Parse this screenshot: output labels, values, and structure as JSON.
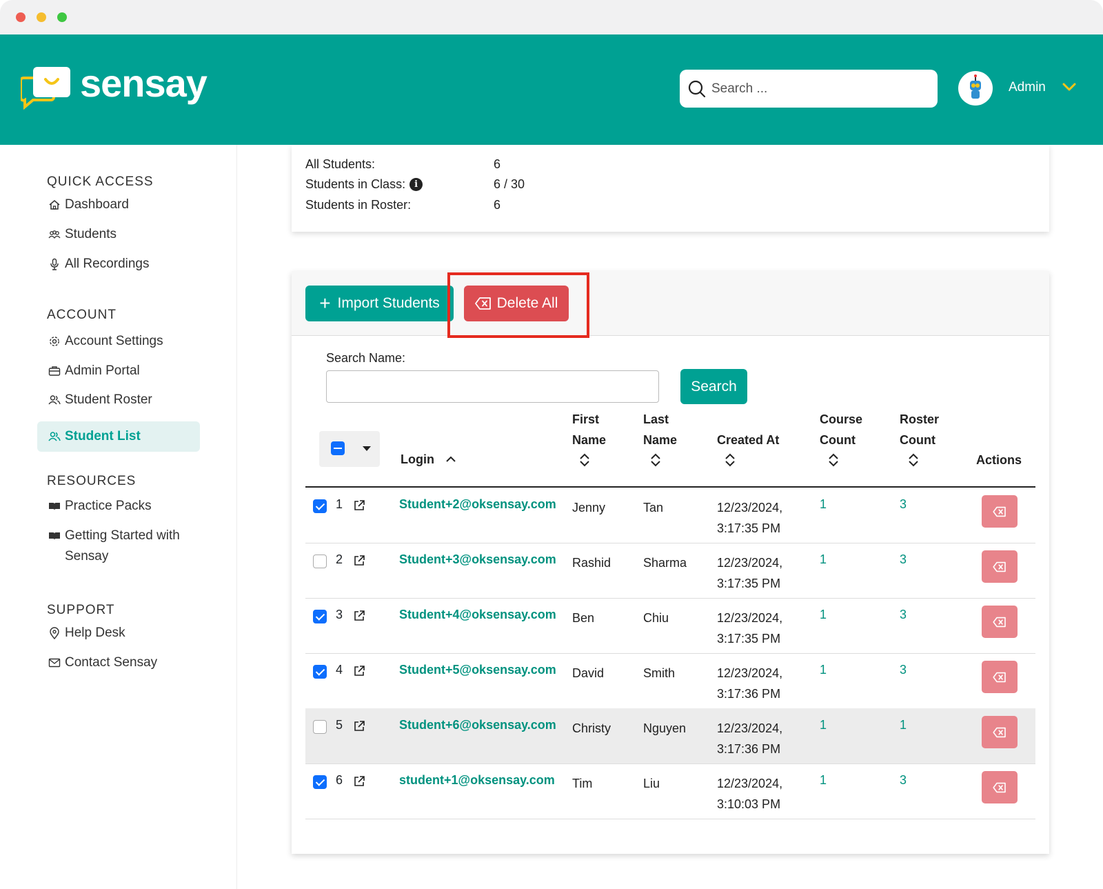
{
  "header": {
    "brand": "sensay",
    "search_placeholder": "Search ...",
    "user_name": "Admin"
  },
  "sidebar": {
    "sections": [
      {
        "title": "QUICK ACCESS",
        "items": [
          {
            "label": "Dashboard",
            "icon": "home-icon"
          },
          {
            "label": "Students",
            "icon": "users-icon"
          },
          {
            "label": "All Recordings",
            "icon": "microphone-icon"
          }
        ]
      },
      {
        "title": "ACCOUNT",
        "items": [
          {
            "label": "Account Settings",
            "icon": "gear-icon"
          },
          {
            "label": "Admin Portal",
            "icon": "briefcase-icon"
          },
          {
            "label": "Student Roster",
            "icon": "people-icon"
          },
          {
            "label": "Student List",
            "icon": "people-icon",
            "active": true
          }
        ]
      },
      {
        "title": "RESOURCES",
        "items": [
          {
            "label": "Practice Packs",
            "icon": "book-icon"
          },
          {
            "label": "Getting Started with Sensay",
            "icon": "book-icon"
          }
        ]
      },
      {
        "title": "SUPPORT",
        "items": [
          {
            "label": "Help Desk",
            "icon": "location-pin-icon"
          },
          {
            "label": "Contact Sensay",
            "icon": "envelope-icon"
          }
        ]
      }
    ]
  },
  "stats": {
    "all_students_label": "All Students:",
    "all_students_value": "6",
    "in_class_label": "Students in Class:",
    "in_class_value": "6 / 30",
    "in_roster_label": "Students in Roster:",
    "in_roster_value": "6"
  },
  "toolbar": {
    "import_label": "Import Students",
    "delete_all_label": "Delete All"
  },
  "search": {
    "label": "Search Name:",
    "value": "",
    "button_label": "Search"
  },
  "table": {
    "headers": {
      "login": "Login",
      "first_name_1": "First",
      "first_name_2": "Name",
      "last_name_1": "Last",
      "last_name_2": "Name",
      "created_at": "Created At",
      "course_count_1": "Course",
      "course_count_2": "Count",
      "roster_count_1": "Roster",
      "roster_count_2": "Count",
      "actions": "Actions"
    },
    "rows": [
      {
        "num": "1",
        "checked": true,
        "login": "Student+2@oksensay.com",
        "first": "Jenny",
        "last": "Tan",
        "date": "12/23/2024,",
        "time": "3:17:35 PM",
        "course": "1",
        "roster": "3"
      },
      {
        "num": "2",
        "checked": false,
        "login": "Student+3@oksensay.com",
        "first": "Rashid",
        "last": "Sharma",
        "date": "12/23/2024,",
        "time": "3:17:35 PM",
        "course": "1",
        "roster": "3"
      },
      {
        "num": "3",
        "checked": true,
        "login": "Student+4@oksensay.com",
        "first": "Ben",
        "last": "Chiu",
        "date": "12/23/2024,",
        "time": "3:17:35 PM",
        "course": "1",
        "roster": "3"
      },
      {
        "num": "4",
        "checked": true,
        "login": "Student+5@oksensay.com",
        "first": "David",
        "last": "Smith",
        "date": "12/23/2024,",
        "time": "3:17:36 PM",
        "course": "1",
        "roster": "3"
      },
      {
        "num": "5",
        "checked": false,
        "login": "Student+6@oksensay.com",
        "first": "Christy",
        "last": "Nguyen",
        "date": "12/23/2024,",
        "time": "3:17:36 PM",
        "course": "1",
        "roster": "1"
      },
      {
        "num": "6",
        "checked": true,
        "login": "student+1@oksensay.com",
        "first": "Tim",
        "last": "Liu",
        "date": "12/23/2024,",
        "time": "3:10:03 PM",
        "course": "1",
        "roster": "3"
      }
    ]
  },
  "colors": {
    "brand": "#00a193",
    "danger": "#dc4d52",
    "danger_light": "#e8848b",
    "checkbox": "#0d6efd",
    "highlight": "#e52b1f"
  }
}
